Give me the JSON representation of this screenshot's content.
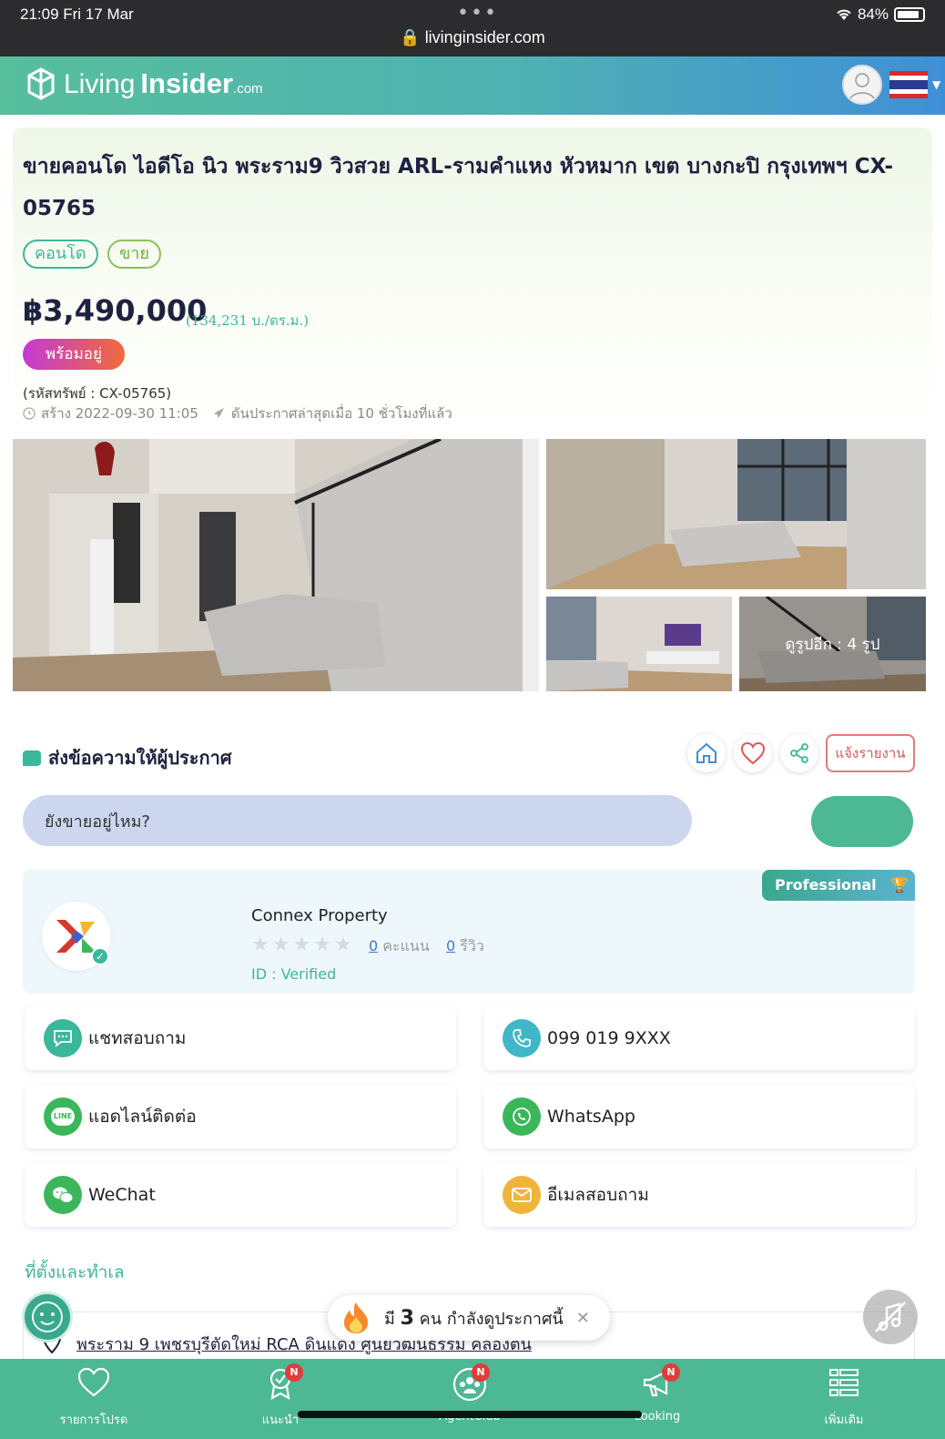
{
  "status_bar": {
    "time": "21:09  Fri 17 Mar",
    "dots": "•••",
    "url": "livinginsider.com",
    "battery": "84%"
  },
  "header": {
    "logo_living": "Living",
    "logo_insider": "Insider",
    "logo_com": ".com"
  },
  "listing": {
    "title": "ขายคอนโด ไอดีโอ นิว พระราม9 วิวสวย ARL-รามคำแหง หัวหมาก เขต บางกะปิ กรุงเทพฯ CX-05765",
    "tags": [
      "คอนโด",
      "ขาย"
    ],
    "price": "฿3,490,000",
    "price_per_sqm": "(134,231 บ./ตร.ม.)",
    "status_badge": "พร้อมอยู่",
    "property_code": "(รหัสทรัพย์ : CX-05765)",
    "created": "สร้าง 2022-09-30 11:05",
    "last_pushed": "ดันประกาศล่าสุดเมื่อ 10 ชั่วโมงที่แล้ว",
    "more_photos": "ดูรูปอีก : 4 รูป"
  },
  "message": {
    "heading": "ส่งข้อความให้ผู้ประกาศ",
    "report_label": "แจ้งรายงาน",
    "input_value": "ยังขายอยู่ไหม?"
  },
  "agent": {
    "badge": "Professional",
    "name": "Connex Property",
    "score_num": "0",
    "score_label": "คะแนน",
    "review_num": "0",
    "review_label": "รีวิว",
    "id_status": "ID : Verified"
  },
  "contacts": [
    {
      "label": "แชทสอบถาม",
      "icon": "chat-icon",
      "color": "#3bb79a"
    },
    {
      "label": "099 019 9XXX",
      "icon": "phone-icon",
      "color": "#3fb7c9"
    },
    {
      "label": "แอดไลน์ติดต่อ",
      "icon": "line-icon",
      "color": "#3bb75a"
    },
    {
      "label": "WhatsApp",
      "icon": "whatsapp-icon",
      "color": "#3bb75a"
    },
    {
      "label": "WeChat",
      "icon": "wechat-icon",
      "color": "#3bb75a"
    },
    {
      "label": "อีเมลสอบถาม",
      "icon": "email-icon",
      "color": "#f0b43a"
    }
  ],
  "location": {
    "heading": "ที่ตั้งและทำเล",
    "address": "พระราม 9 เพชรบุรีตัดใหม่ RCA ดินแดง ศูนย์วัฒนธรรม คลองตัน"
  },
  "viewing": {
    "prefix": "มี",
    "count": "3",
    "suffix": "คน กำลังดูประกาศนี้"
  },
  "bottom_nav": [
    {
      "label": "รายการโปรด",
      "icon": "heart-icon",
      "badge": ""
    },
    {
      "label": "แนะนำ",
      "icon": "award-icon",
      "badge": "N"
    },
    {
      "label": "AgentClub",
      "icon": "group-icon",
      "badge": "N"
    },
    {
      "label": "Looking",
      "icon": "megaphone-icon",
      "badge": "N"
    },
    {
      "label": "เพิ่มเติม",
      "icon": "menu-icon",
      "badge": ""
    }
  ]
}
